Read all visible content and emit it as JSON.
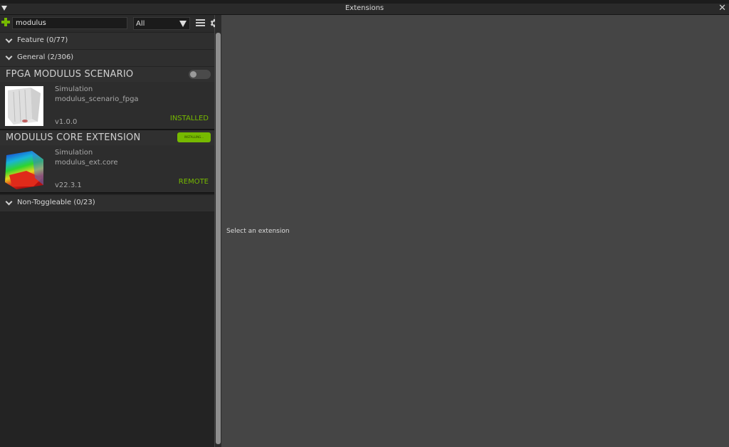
{
  "window": {
    "title": "Extensions"
  },
  "toolbar": {
    "search_value": "modulus",
    "filter_selected": "All"
  },
  "sections": {
    "feature": "Feature (0/77)",
    "general": "General (2/306)",
    "non_toggleable": "Non-Toggleable (0/23)"
  },
  "extensions": [
    {
      "title": "FPGA MODULUS SCENARIO",
      "category": "Simulation",
      "id": "modulus_scenario_fpga",
      "version": "v1.0.0",
      "state": "INSTALLED",
      "enabled": false
    },
    {
      "title": "MODULUS CORE EXTENSION",
      "category": "Simulation",
      "id": "modulus_ext.core",
      "version": "v22.3.1",
      "state": "REMOTE",
      "button_label": "INSTALLING..."
    }
  ],
  "details": {
    "empty_message": "Select an extension"
  },
  "colors": {
    "accent": "#76b900",
    "panel": "#232323",
    "background": "#454545"
  },
  "icons": [
    "collapse-triangle-icon",
    "close-icon",
    "add-icon",
    "hamburger-menu-icon",
    "gear-icon",
    "chevron-down-icon"
  ]
}
